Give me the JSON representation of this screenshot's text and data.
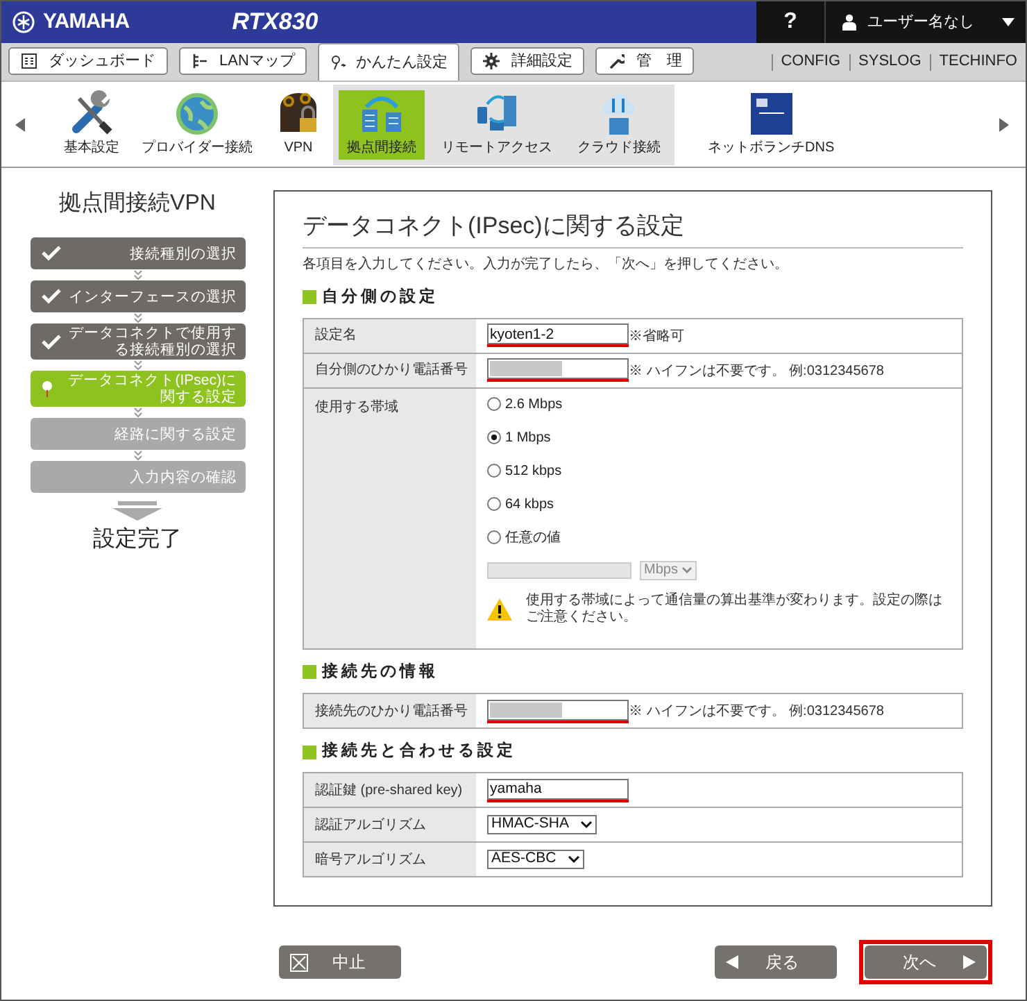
{
  "header": {
    "logo": "YAMAHA",
    "model": "RTX830",
    "help": "?",
    "user": "ユーザー名なし"
  },
  "tabs": [
    {
      "label": "ダッシュボード",
      "selected": false
    },
    {
      "label": "LANマップ",
      "selected": false
    },
    {
      "label": "かんたん設定",
      "selected": true
    },
    {
      "label": "詳細設定",
      "selected": false
    },
    {
      "label": "管　理",
      "selected": false
    }
  ],
  "links": [
    "CONFIG",
    "SYSLOG",
    "TECHINFO"
  ],
  "menu_items": [
    {
      "label": "基本設定",
      "selected": false,
      "grouped": false
    },
    {
      "label": "プロバイダー接続",
      "selected": false,
      "grouped": false
    },
    {
      "label": "VPN",
      "selected": false,
      "grouped": false
    },
    {
      "label": "拠点間接続",
      "selected": true,
      "grouped": true
    },
    {
      "label": "リモートアクセス",
      "selected": false,
      "grouped": true
    },
    {
      "label": "クラウド接続",
      "selected": false,
      "grouped": true
    },
    {
      "label": "ネットボランチDNS",
      "selected": false,
      "grouped": false
    }
  ],
  "sidebar": {
    "title": "拠点間接続VPN",
    "steps": [
      {
        "label": "接続種別の選択",
        "done": true,
        "current": false
      },
      {
        "label": "インターフェースの選択",
        "done": true,
        "current": false
      },
      {
        "label": "データコネクトで使用する接続種別の選択",
        "done": true,
        "current": false
      },
      {
        "label": "データコネクト(IPsec)に関する設定",
        "done": false,
        "current": true
      },
      {
        "label": "経路に関する設定",
        "done": false,
        "current": false
      },
      {
        "label": "入力内容の確認",
        "done": false,
        "current": false
      }
    ],
    "final": "設定完了"
  },
  "form": {
    "title": "データコネクト(IPsec)に関する設定",
    "instruction": "各項目を入力してください。入力が完了したら、「次へ」を押してください。",
    "sections": [
      {
        "heading": "自分側の設定",
        "rows": [
          {
            "kind": "text",
            "label": "設定名",
            "value": "kyoten1-2",
            "note": "※省略可"
          },
          {
            "kind": "text",
            "label": "自分側のひかり電話番号",
            "value": "",
            "redacted": true,
            "note": "※ ハイフンは不要です。 例:0312345678"
          },
          {
            "kind": "radio",
            "label": "使用する帯域",
            "options": [
              {
                "label": "2.6 Mbps",
                "selected": false
              },
              {
                "label": "1 Mbps",
                "selected": true
              },
              {
                "label": "512 kbps",
                "selected": false
              },
              {
                "label": "64 kbps",
                "selected": false
              },
              {
                "label": "任意の値",
                "selected": false
              }
            ],
            "unit": "Mbps",
            "warning": "使用する帯域によって通信量の算出基準が変わります。設定の際はご注意ください。"
          }
        ]
      },
      {
        "heading": "接続先の情報",
        "rows": [
          {
            "kind": "text",
            "label": "接続先のひかり電話番号",
            "value": "",
            "redacted": true,
            "note": "※ ハイフンは不要です。 例:0312345678"
          }
        ]
      },
      {
        "heading": "接続先と合わせる設定",
        "rows": [
          {
            "kind": "text",
            "label": "認証鍵 (pre-shared key)",
            "value": "yamaha"
          },
          {
            "kind": "select",
            "label": "認証アルゴリズム",
            "value": "HMAC-SHA"
          },
          {
            "kind": "select",
            "label": "暗号アルゴリズム",
            "value": "AES-CBC"
          }
        ]
      }
    ]
  },
  "buttons": [
    {
      "kind": "cancel",
      "label": "中止"
    },
    {
      "kind": "back",
      "label": "戻る"
    },
    {
      "kind": "next",
      "label": "次へ",
      "highlighted": true
    }
  ]
}
